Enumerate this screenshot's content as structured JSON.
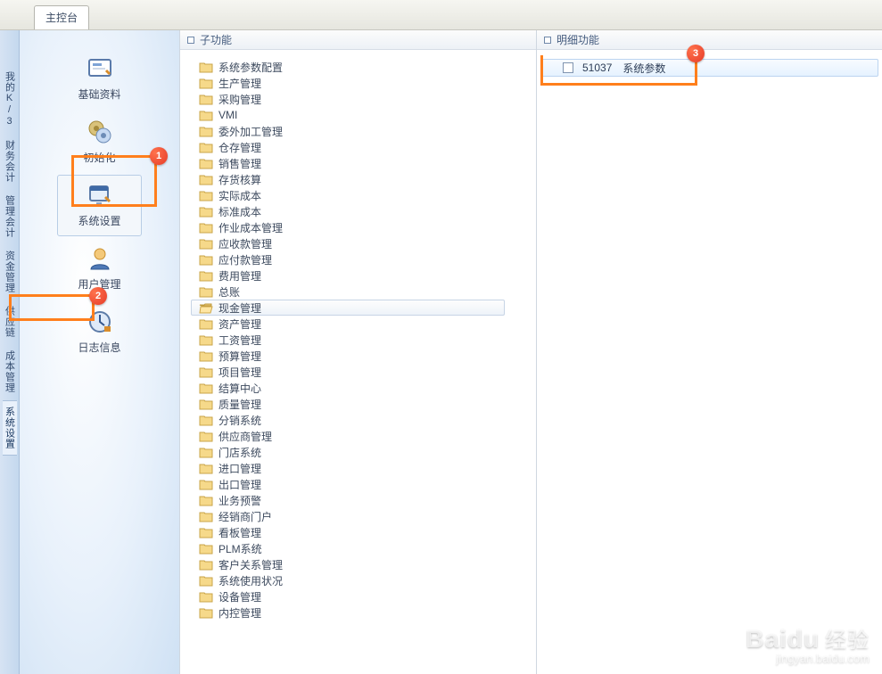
{
  "tab": {
    "main": "主控台"
  },
  "vtabs": [
    "我的K/3",
    "财务会计",
    "管理会计",
    "资金管理",
    "供应链",
    "成本管理",
    "系统设置"
  ],
  "vtab_selected_index": 6,
  "nav": {
    "items": [
      {
        "label": "基础资料"
      },
      {
        "label": "初始化"
      },
      {
        "label": "系统设置"
      },
      {
        "label": "用户管理"
      },
      {
        "label": "日志信息"
      }
    ],
    "selected_index": 2
  },
  "tree": {
    "header": "子功能",
    "items": [
      "系统参数配置",
      "生产管理",
      "采购管理",
      "VMI",
      "委外加工管理",
      "仓存管理",
      "销售管理",
      "存货核算",
      "实际成本",
      "标准成本",
      "作业成本管理",
      "应收款管理",
      "应付款管理",
      "费用管理",
      "总账",
      "现金管理",
      "资产管理",
      "工资管理",
      "预算管理",
      "项目管理",
      "结算中心",
      "质量管理",
      "分销系统",
      "供应商管理",
      "门店系统",
      "进口管理",
      "出口管理",
      "业务预警",
      "经销商门户",
      "看板管理",
      "PLM系统",
      "客户关系管理",
      "系统使用状况",
      "设备管理",
      "内控管理"
    ],
    "selected_index": 15
  },
  "detail": {
    "header": "明细功能",
    "items": [
      {
        "code": "51037",
        "label": "系统参数"
      }
    ]
  },
  "annotations": {
    "badge1": "1",
    "badge2": "2",
    "badge3": "3"
  },
  "watermark": {
    "brand": "Baidu",
    "cn": "经验",
    "url": "jingyan.baidu.com"
  },
  "colors": {
    "highlight": "#ff7f1c",
    "badge": "#e63c29",
    "sel_bg": "#eef3f9",
    "accent": "#bcd4f0"
  }
}
